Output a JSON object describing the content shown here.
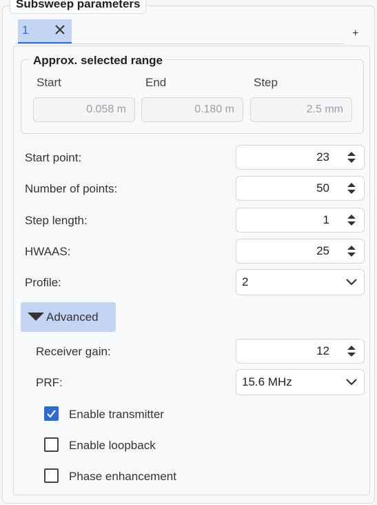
{
  "group_title": "Subsweep parameters",
  "tabs": [
    {
      "label": "1",
      "active": true
    }
  ],
  "add_tab_label": "+",
  "range": {
    "title": "Approx. selected range",
    "start_label": "Start",
    "end_label": "End",
    "step_label": "Step",
    "start_value": "0.058 m",
    "end_value": "0.180 m",
    "step_value": "2.5 mm"
  },
  "fields": {
    "start_point": {
      "label": "Start point:",
      "value": "23"
    },
    "num_points": {
      "label": "Number of points:",
      "value": "50"
    },
    "step_length": {
      "label": "Step length:",
      "value": "1"
    },
    "hwaas": {
      "label": "HWAAS:",
      "value": "25"
    },
    "profile": {
      "label": "Profile:",
      "value": "2"
    }
  },
  "advanced": {
    "label": "Advanced",
    "expanded": true,
    "receiver_gain": {
      "label": "Receiver gain:",
      "value": "12"
    },
    "prf": {
      "label": "PRF:",
      "value": "15.6 MHz"
    },
    "checkboxes": [
      {
        "label": "Enable transmitter",
        "checked": true
      },
      {
        "label": "Enable loopback",
        "checked": false
      },
      {
        "label": "Phase enhancement",
        "checked": false
      }
    ]
  },
  "icons": {
    "tab_close": "close-icon",
    "spin": "spin-arrows-icon",
    "combo": "chevron-down-icon",
    "advanced": "triangle-down-icon",
    "check": "checkmark-icon"
  },
  "colors": {
    "accent": "#2f6ad0",
    "selection_bg": "#c4d5f3",
    "border": "#d3d6db",
    "panel_bg": "#f8f9fa",
    "disabled_text": "#9a9da3"
  }
}
